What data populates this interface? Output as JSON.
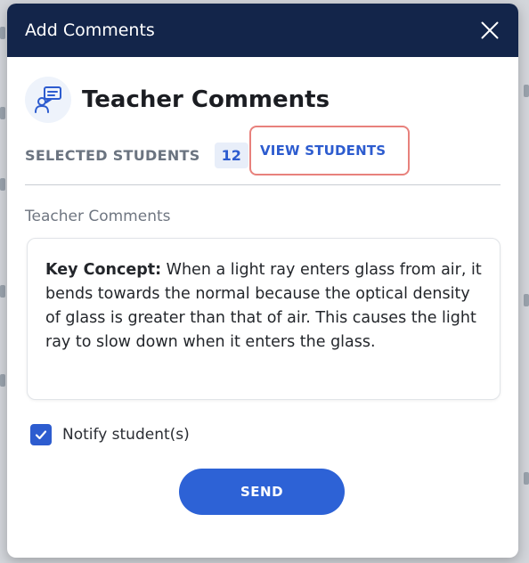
{
  "modal": {
    "title": "Add Comments",
    "close_icon": "close-icon"
  },
  "section": {
    "icon": "teacher-comment-icon",
    "title": "Teacher Comments"
  },
  "selected_students": {
    "label": "SELECTED STUDENTS",
    "count": "12",
    "view_link": "VIEW STUDENTS"
  },
  "comments": {
    "field_label": "Teacher Comments",
    "key_prefix": "Key Concept:",
    "body": " When a light ray enters glass from air, it bends towards the normal because the optical density of glass is greater than that of air. This causes the light ray to slow down when it enters the glass."
  },
  "notify": {
    "label": "Notify student(s)",
    "checked": true
  },
  "actions": {
    "send_label": "SEND"
  },
  "colors": {
    "header_bg": "#13254a",
    "accent": "#2d5ccf",
    "highlight_border": "#e8817c"
  }
}
